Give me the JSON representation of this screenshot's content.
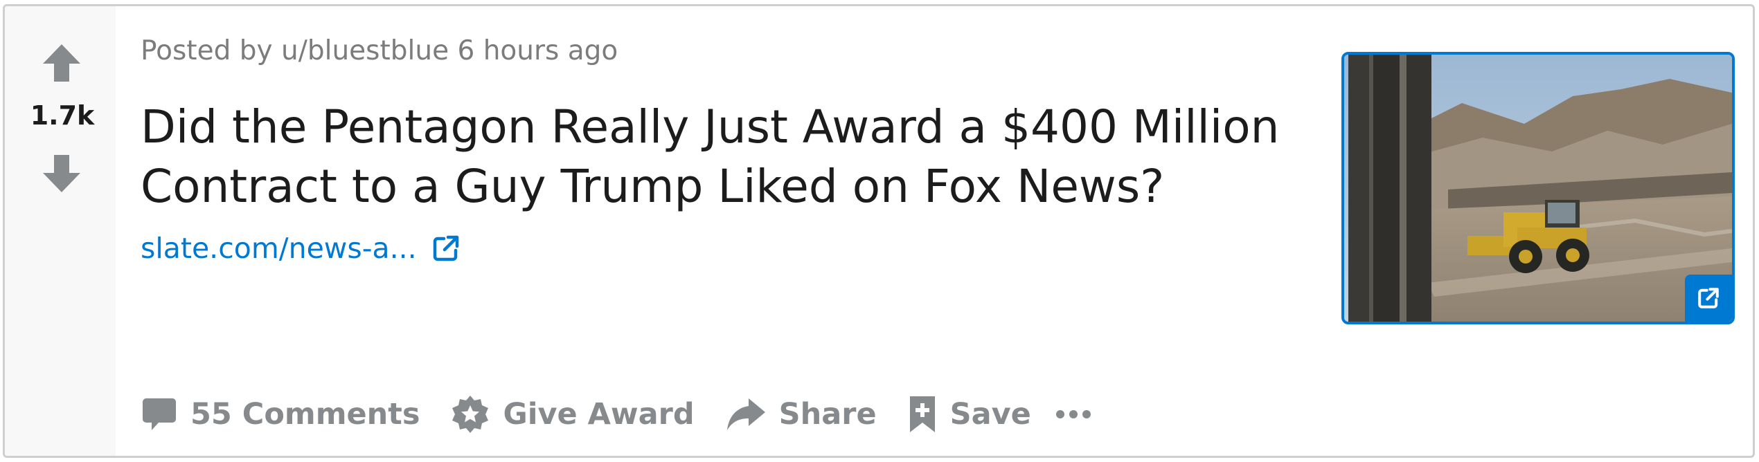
{
  "post": {
    "score": "1.7k",
    "meta": {
      "prefix": "Posted by",
      "author": "u/bluestblue",
      "time": "6 hours ago"
    },
    "title": "Did the Pentagon Really Just Award a $400 Million Contract to a Guy Trump Liked on Fox News?",
    "link_text": "slate.com/news-a...",
    "thumbnail_icon": "external-link-icon"
  },
  "actions": {
    "comments_label": "55 Comments",
    "award_label": "Give Award",
    "share_label": "Share",
    "save_label": "Save"
  },
  "colors": {
    "link_blue": "#0079d3",
    "icon_gray": "#878a8c",
    "title_text": "#1c1c1c",
    "meta_text": "#7c7c7c",
    "vote_column_bg": "#f8f8f9"
  }
}
